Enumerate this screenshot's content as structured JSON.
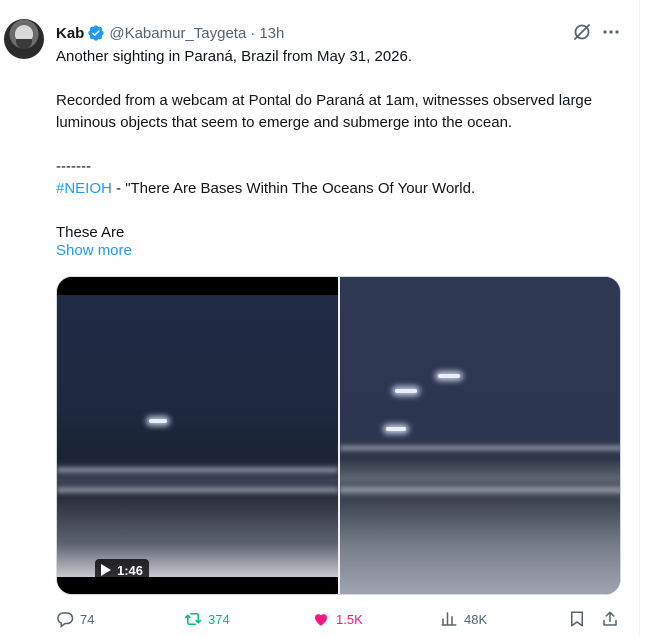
{
  "author": {
    "name": "Kab",
    "handle": "@Kabamur_Taygeta",
    "separator": "·",
    "time": "13h"
  },
  "post": {
    "line1": "Another sighting in Paraná, Brazil from May 31, 2026.",
    "line2": "Recorded from a webcam at Pontal do Paraná at 1am, witnesses observed large luminous objects that seem to emerge and submerge into the ocean.",
    "line3": "-------",
    "hashtag": "#NEIOH",
    "line4_rest": " - \"There Are Bases Within The Oceans Of Your World.",
    "line5": "These Are",
    "show_more": "Show more"
  },
  "media": {
    "duration": "1:46"
  },
  "actions": {
    "replies": "74",
    "reposts": "374",
    "likes": "1.5K",
    "views": "48K"
  },
  "colors": {
    "link": "#1d9bf0",
    "repost": "#00ba7c",
    "like": "#f91880",
    "muted": "#536471"
  },
  "icons": [
    "verified-badge-icon",
    "grok-icon",
    "more-icon",
    "play-icon",
    "reply-icon",
    "repost-icon",
    "like-icon",
    "views-icon",
    "bookmark-icon",
    "share-icon"
  ]
}
